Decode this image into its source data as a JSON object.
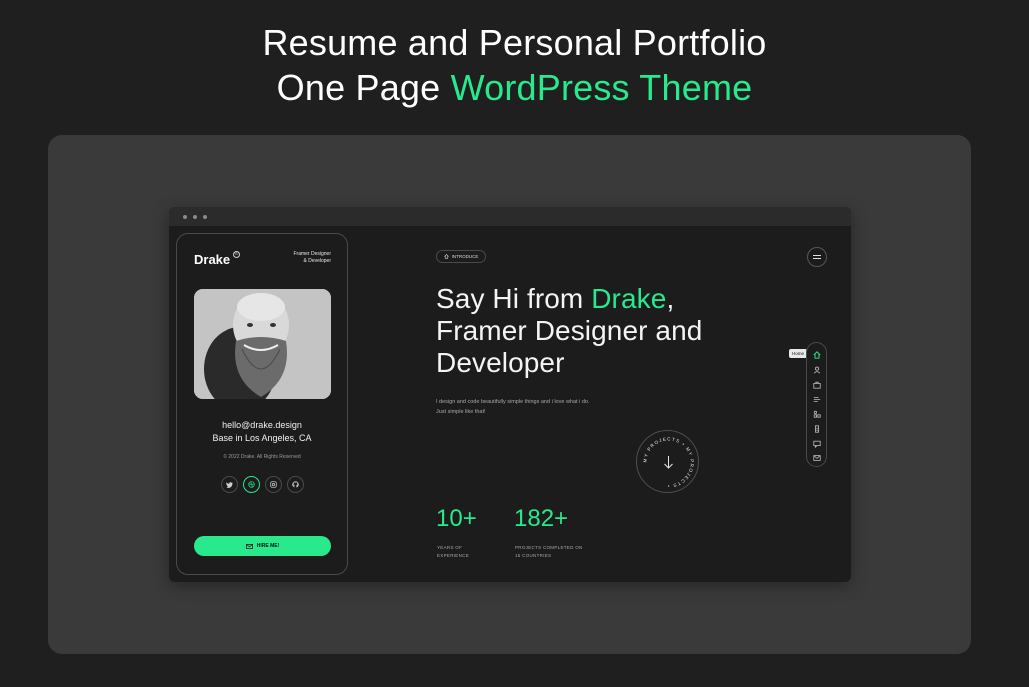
{
  "headline": {
    "line1": "Resume and Personal Portfolio",
    "line2_plain": "One Page ",
    "line2_accent": "WordPress Theme"
  },
  "colors": {
    "accent": "#28e98c",
    "bg": "#1f1f1f",
    "stage": "#3a3a3b"
  },
  "profile": {
    "brand": "Drake",
    "brand_mark": "®",
    "role_line1": "Framer Designer",
    "role_line2": "& Developer",
    "email": "hello@drake.design",
    "location": "Base in Los Angeles, CA",
    "copyright": "© 2022 Drake. All Rights Reserved",
    "socials": [
      "twitter-icon",
      "dribbble-icon",
      "instagram-icon",
      "github-icon"
    ],
    "hire_label": "HIRE ME!"
  },
  "main": {
    "intro_label": "INTRODUCE",
    "hero_part1": "Say Hi from ",
    "hero_name": "Drake",
    "hero_part2": ",",
    "hero_line2": "Framer Designer and",
    "hero_line3": "Developer",
    "desc_line1": "I design and code beautifully simple things and i love what i do.",
    "desc_line2": "Just simple like that!",
    "badge_text": "MY PROJECTS • MY PROJECTS •",
    "stats": [
      {
        "value": "10+",
        "label_line1": "YEARS OF",
        "label_line2": "EXPERIENCE"
      },
      {
        "value": "182+",
        "label_line1": "PROJECTS COMPLETED ON",
        "label_line2": "15 COUNTRIES"
      }
    ],
    "tooltip": "Home"
  }
}
